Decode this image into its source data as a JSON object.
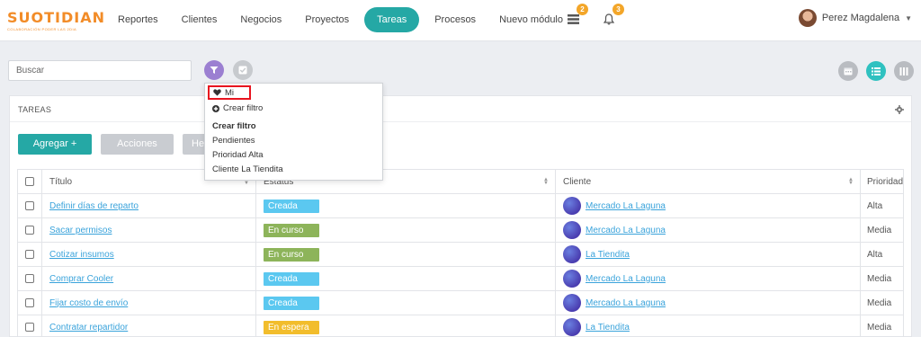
{
  "brand": {
    "name": "SUOTIDIAN",
    "tagline": "COLABORACIÓN PODER LAS 2DIA"
  },
  "nav": {
    "items": [
      "Reportes",
      "Clientes",
      "Negocios",
      "Proyectos",
      "Tareas",
      "Procesos",
      "Nuevo módulo"
    ],
    "active": "Tareas",
    "list_badge": "2",
    "bell_badge": "3"
  },
  "user": {
    "name": "Perez Magdalena"
  },
  "toolbar": {
    "search_placeholder": "Buscar"
  },
  "panel": {
    "title": "TAREAS",
    "add_button": "Agregar +",
    "actions_button": "Acciones",
    "third_button": "He"
  },
  "table": {
    "headers": {
      "title": "Título",
      "status": "Estatus",
      "client": "Cliente",
      "priority": "Prioridad"
    },
    "rows": [
      {
        "title": "Definir días de reparto",
        "status": "Creada",
        "status_color": "#5bc8f0",
        "client": "Mercado La Laguna",
        "priority": "Alta"
      },
      {
        "title": "Sacar permisos",
        "status": "En curso",
        "status_color": "#8db45a",
        "client": "Mercado La Laguna",
        "priority": "Media"
      },
      {
        "title": "Cotizar insumos",
        "status": "En curso",
        "status_color": "#8db45a",
        "client": "La Tiendita",
        "priority": "Alta"
      },
      {
        "title": "Comprar Cooler",
        "status": "Creada",
        "status_color": "#5bc8f0",
        "client": "Mercado La Laguna",
        "priority": "Media"
      },
      {
        "title": "Fijar costo de envío",
        "status": "Creada",
        "status_color": "#5bc8f0",
        "client": "Mercado La Laguna",
        "priority": "Media"
      },
      {
        "title": "Contratar repartidor",
        "status": "En espera",
        "status_color": "#f2bd2c",
        "client": "La Tiendita",
        "priority": "Media"
      }
    ]
  },
  "filter_dropdown": {
    "mine": "Mi",
    "create_filter": "Crear filtro",
    "section_title": "Crear filtro",
    "options": [
      "Pendientes",
      "Prioridad Alta",
      "Cliente La Tiendita"
    ]
  },
  "colors": {
    "accent": "#25a8a5",
    "filter": "#9b7fd1",
    "badge": "#f3a629",
    "link": "#3aa3db",
    "highlight": "#e8141f"
  }
}
